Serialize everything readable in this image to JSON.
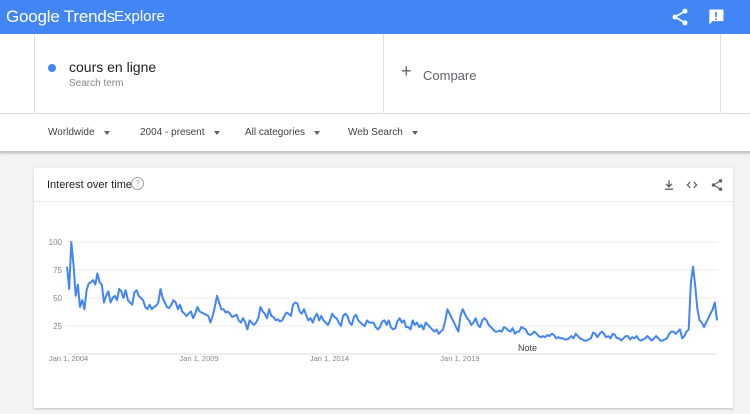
{
  "topbar": {
    "logo": "Google Trends",
    "section": "Explore",
    "background": "#4285f4",
    "share_icon": "share-icon",
    "feedback_icon": "feedback-icon"
  },
  "search": {
    "term": "cours en ligne",
    "term_subtitle": "Search term",
    "term_color": "#4285f4",
    "compare_label": "Compare"
  },
  "filters": {
    "region": "Worldwide",
    "period": "2004 - present",
    "category": "All categories",
    "search_type": "Web Search"
  },
  "card": {
    "title": "Interest over time",
    "help_icon": "help-icon",
    "download_icon": "download-icon",
    "embed_icon": "embed-icon",
    "share_icon": "share-icon",
    "note_label": "Note"
  },
  "chart_data": {
    "type": "line",
    "series_color": "#4285f4",
    "ylim": [
      0,
      100
    ],
    "y_ticks": [
      25,
      50,
      75,
      100
    ],
    "x_ticks": [
      "Jan 1, 2004",
      "Jan 1, 2009",
      "Jan 1, 2014",
      "Jan 1, 2019"
    ],
    "x_start": "2004-01",
    "x_end": "2020-11",
    "grid": true,
    "legend": "none",
    "values": [
      78,
      58,
      100,
      80,
      52,
      62,
      42,
      48,
      40,
      57,
      63,
      64,
      66,
      62,
      72,
      64,
      62,
      46,
      52,
      56,
      46,
      50,
      52,
      48,
      58,
      56,
      50,
      57,
      48,
      46,
      44,
      55,
      57,
      52,
      50,
      48,
      42,
      40,
      44,
      40,
      42,
      43,
      46,
      58,
      50,
      46,
      42,
      41,
      44,
      48,
      46,
      40,
      44,
      38,
      36,
      34,
      36,
      38,
      32,
      36,
      42,
      38,
      37,
      36,
      35,
      34,
      28,
      34,
      42,
      52,
      46,
      40,
      40,
      37,
      38,
      36,
      33,
      34,
      35,
      30,
      28,
      32,
      28,
      22,
      30,
      28,
      26,
      28,
      32,
      42,
      38,
      36,
      32,
      40,
      34,
      33,
      30,
      31,
      29,
      30,
      34,
      37,
      36,
      34,
      44,
      46,
      45,
      38,
      36,
      40,
      35,
      30,
      32,
      28,
      33,
      36,
      30,
      34,
      30,
      28,
      26,
      30,
      36,
      33,
      32,
      28,
      25,
      34,
      36,
      34,
      28,
      26,
      33,
      35,
      30,
      28,
      26,
      25,
      30,
      28,
      28,
      28,
      24,
      22,
      24,
      29,
      30,
      26,
      30,
      24,
      22,
      23,
      29,
      32,
      28,
      30,
      24,
      24,
      22,
      30,
      26,
      28,
      24,
      26,
      22,
      28,
      26,
      24,
      22,
      20,
      22,
      18,
      20,
      22,
      30,
      40,
      36,
      32,
      28,
      24,
      20,
      34,
      40,
      36,
      32,
      30,
      26,
      28,
      32,
      26,
      24,
      30,
      32,
      30,
      26,
      24,
      22,
      20,
      20,
      21,
      20,
      24,
      23,
      21,
      20,
      23,
      18,
      20,
      20,
      24,
      23,
      22,
      18,
      17,
      18,
      20,
      18,
      16,
      15,
      16,
      15,
      17,
      16,
      18,
      17,
      14,
      15,
      14,
      14,
      13,
      13,
      14,
      16,
      14,
      18,
      16,
      14,
      13,
      12,
      12,
      13,
      14,
      19,
      18,
      15,
      18,
      20,
      18,
      15,
      16,
      14,
      18,
      17,
      14,
      14,
      12,
      14,
      16,
      16,
      13,
      15,
      14,
      16,
      13,
      12,
      13,
      14,
      16,
      14,
      12,
      14,
      16,
      14,
      12,
      12,
      13,
      14,
      18,
      20,
      20,
      18,
      20,
      22,
      14,
      16,
      20,
      22,
      64,
      78,
      60,
      40,
      30,
      28,
      24,
      28,
      32,
      36,
      40,
      46,
      30
    ]
  }
}
